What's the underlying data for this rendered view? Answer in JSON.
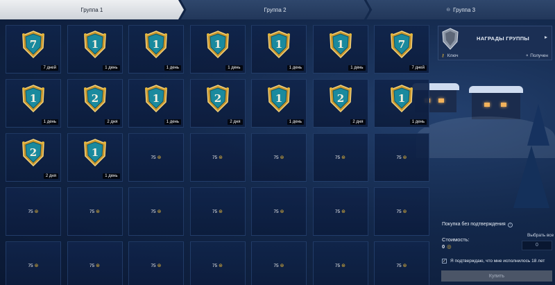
{
  "tabs": [
    {
      "label": "Группа 1",
      "active": true,
      "locked": false
    },
    {
      "label": "Группа 2",
      "active": false,
      "locked": false
    },
    {
      "label": "Группа 3",
      "active": false,
      "locked": true
    }
  ],
  "icons": {
    "lock": "lock-icon",
    "coin": "gold-coin-icon",
    "key": "key-icon",
    "chevron": "chevron-right-icon",
    "info": "info-icon",
    "check": "check-icon"
  },
  "colors": {
    "accent_gold": "#e4b63b",
    "badge_teal": "#1a8a9e",
    "active_tab": "#e4e8ec",
    "button_disabled": "#4b5567"
  },
  "grid": {
    "cells": [
      {
        "type": "premium",
        "number": "7",
        "duration": "7 дней"
      },
      {
        "type": "premium",
        "number": "1",
        "duration": "1 день"
      },
      {
        "type": "premium",
        "number": "1",
        "duration": "1 день"
      },
      {
        "type": "premium",
        "number": "1",
        "duration": "1 день"
      },
      {
        "type": "premium",
        "number": "1",
        "duration": "1 день"
      },
      {
        "type": "premium",
        "number": "1",
        "duration": "1 день"
      },
      {
        "type": "premium",
        "number": "7",
        "duration": "7 дней"
      },
      {
        "type": "premium",
        "number": "1",
        "duration": "1 день"
      },
      {
        "type": "premium",
        "number": "2",
        "duration": "2 дня"
      },
      {
        "type": "premium",
        "number": "1",
        "duration": "1 день"
      },
      {
        "type": "premium",
        "number": "2",
        "duration": "2 дня"
      },
      {
        "type": "premium",
        "number": "1",
        "duration": "1 день"
      },
      {
        "type": "premium",
        "number": "2",
        "duration": "2 дня"
      },
      {
        "type": "premium",
        "number": "1",
        "duration": "1 день"
      },
      {
        "type": "premium",
        "number": "2",
        "duration": "2 дня"
      },
      {
        "type": "premium",
        "number": "1",
        "duration": "1 день"
      },
      {
        "type": "gold",
        "amount": "75"
      },
      {
        "type": "gold",
        "amount": "75"
      },
      {
        "type": "gold",
        "amount": "75"
      },
      {
        "type": "gold",
        "amount": "75"
      },
      {
        "type": "gold",
        "amount": "75"
      },
      {
        "type": "gold",
        "amount": "75"
      },
      {
        "type": "gold",
        "amount": "75"
      },
      {
        "type": "gold",
        "amount": "75"
      },
      {
        "type": "gold",
        "amount": "75"
      },
      {
        "type": "gold",
        "amount": "75"
      },
      {
        "type": "gold",
        "amount": "75"
      },
      {
        "type": "gold",
        "amount": "75"
      },
      {
        "type": "gold",
        "amount": "75"
      },
      {
        "type": "gold",
        "amount": "75"
      },
      {
        "type": "gold",
        "amount": "75"
      },
      {
        "type": "gold",
        "amount": "75"
      },
      {
        "type": "gold",
        "amount": "75"
      },
      {
        "type": "gold",
        "amount": "75"
      },
      {
        "type": "gold",
        "amount": "75"
      }
    ]
  },
  "rewards_panel": {
    "title": "НАГРАДЫ ГРУППЫ",
    "key_label": "Ключ",
    "status_label": "Получен"
  },
  "purchase": {
    "note": "Покупка без подтверждения",
    "cost_label": "Стоимость:",
    "cost_value": "0",
    "select_all_label": "Выбрать все",
    "quantity": "0",
    "age_confirm": "Я подтверждаю, что мне исполнилось 18 лет",
    "age_confirm_checked": true,
    "buy_label": "Купить"
  }
}
